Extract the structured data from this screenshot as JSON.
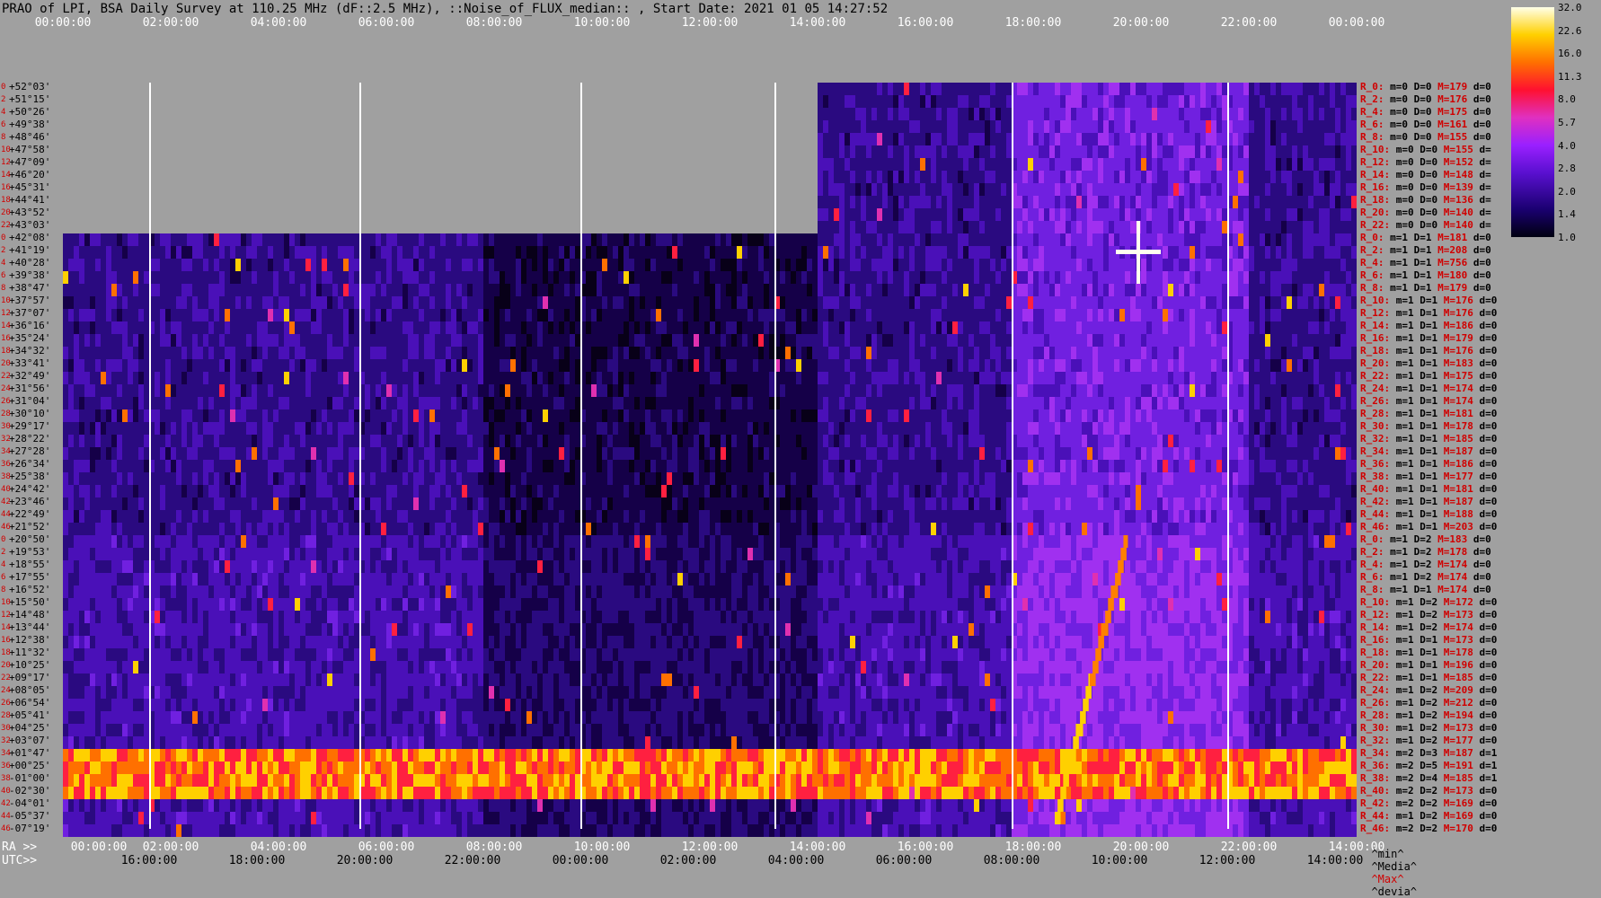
{
  "title": "PRAO of LPI, BSA Daily Survey at 110.25 MHz (dF::2.5 MHz), ::Noise_of_FLUX_median:: , Start Date: 2021 01 05 14:27:52",
  "axis": {
    "top_ticks": [
      "00:00:00",
      "02:00:00",
      "04:00:00",
      "06:00:00",
      "08:00:00",
      "10:00:00",
      "12:00:00",
      "14:00:00",
      "16:00:00",
      "18:00:00",
      "20:00:00",
      "22:00:00",
      "00:00:00"
    ],
    "ra_prefix": "RA >>",
    "ra_ticks": [
      "00:00:00",
      "02:00:00",
      "04:00:00",
      "06:00:00",
      "08:00:00",
      "10:00:00",
      "12:00:00",
      "14:00:00",
      "16:00:00",
      "18:00:00",
      "20:00:00",
      "22:00:00",
      "14:00:00"
    ],
    "utc_prefix": "UTC>>",
    "utc_ticks": [
      "16:00:00",
      "18:00:00",
      "20:00:00",
      "22:00:00",
      "00:00:00",
      "02:00:00",
      "04:00:00",
      "06:00:00",
      "08:00:00",
      "10:00:00",
      "12:00:00",
      "14:00:00"
    ]
  },
  "declinations": [
    "+52°03'",
    "+51°15'",
    "+50°26'",
    "+49°38'",
    "+48°46'",
    "+47°58'",
    "+47°09'",
    "+46°20'",
    "+45°31'",
    "+44°41'",
    "+43°52'",
    "+43°03'",
    "+42°08'",
    "+41°19'",
    "+40°28'",
    "+39°38'",
    "+38°47'",
    "+37°57'",
    "+37°07'",
    "+36°16'",
    "+35°24'",
    "+34°32'",
    "+33°41'",
    "+32°49'",
    "+31°56'",
    "+31°04'",
    "+30°10'",
    "+29°17'",
    "+28°22'",
    "+27°28'",
    "+26°34'",
    "+25°38'",
    "+24°42'",
    "+23°46'",
    "+22°49'",
    "+21°52'",
    "+20°50'",
    "+19°53'",
    "+18°55'",
    "+17°55'",
    "+16°52'",
    "+15°50'",
    "+14°48'",
    "+13°44'",
    "+12°38'",
    "+11°32'",
    "+10°25'",
    "+09°17'",
    "+08°05'",
    "+06°54'",
    "+05°41'",
    "+04°25'",
    "+03°07'",
    "+01°47'",
    "+00°25'",
    "-01°00'",
    "-02°30'",
    "-04°01'",
    "-05°37'",
    "-07°19'"
  ],
  "beam_numbers": [
    "0",
    "2",
    "4",
    "6",
    "8",
    "10",
    "12",
    "14",
    "16",
    "18",
    "20",
    "22",
    "0",
    "2",
    "4",
    "6",
    "8",
    "10",
    "12",
    "14",
    "16",
    "18",
    "20",
    "22",
    "24",
    "26",
    "28",
    "30",
    "32",
    "34",
    "36",
    "38",
    "40",
    "42",
    "44",
    "46",
    "0",
    "2",
    "4",
    "6",
    "8",
    "10",
    "12",
    "14",
    "16",
    "18",
    "20",
    "22",
    "24",
    "26",
    "28",
    "30",
    "32",
    "34",
    "36",
    "38",
    "40",
    "42",
    "44",
    "46"
  ],
  "row_stats": [
    {
      "r": "R_0:",
      "m": "0",
      "d": "0",
      "M": "179",
      "dv": "0"
    },
    {
      "r": "R_2:",
      "m": "0",
      "d": "0",
      "M": "176",
      "dv": "0"
    },
    {
      "r": "R_4:",
      "m": "0",
      "d": "0",
      "M": "175",
      "dv": "0"
    },
    {
      "r": "R_6:",
      "m": "0",
      "d": "0",
      "M": "161",
      "dv": "0"
    },
    {
      "r": "R_8:",
      "m": "0",
      "d": "0",
      "M": "155",
      "dv": "0"
    },
    {
      "r": "R_10:",
      "m": "0",
      "d": "0",
      "M": "155",
      "dv": ""
    },
    {
      "r": "R_12:",
      "m": "0",
      "d": "0",
      "M": "152",
      "dv": ""
    },
    {
      "r": "R_14:",
      "m": "0",
      "d": "0",
      "M": "148",
      "dv": ""
    },
    {
      "r": "R_16:",
      "m": "0",
      "d": "0",
      "M": "139",
      "dv": ""
    },
    {
      "r": "R_18:",
      "m": "0",
      "d": "0",
      "M": "136",
      "dv": ""
    },
    {
      "r": "R_20:",
      "m": "0",
      "d": "0",
      "M": "140",
      "dv": ""
    },
    {
      "r": "R_22:",
      "m": "0",
      "d": "0",
      "M": "140",
      "dv": ""
    },
    {
      "r": "R_0:",
      "m": "1",
      "d": "1",
      "M": "181",
      "dv": "0"
    },
    {
      "r": "R_2:",
      "m": "1",
      "d": "1",
      "M": "208",
      "dv": "0"
    },
    {
      "r": "R_4:",
      "m": "1",
      "d": "1",
      "M": "756",
      "dv": "0"
    },
    {
      "r": "R_6:",
      "m": "1",
      "d": "1",
      "M": "180",
      "dv": "0"
    },
    {
      "r": "R_8:",
      "m": "1",
      "d": "1",
      "M": "179",
      "dv": "0"
    },
    {
      "r": "R_10:",
      "m": "1",
      "d": "1",
      "M": "176",
      "dv": "0"
    },
    {
      "r": "R_12:",
      "m": "1",
      "d": "1",
      "M": "176",
      "dv": "0"
    },
    {
      "r": "R_14:",
      "m": "1",
      "d": "1",
      "M": "186",
      "dv": "0"
    },
    {
      "r": "R_16:",
      "m": "1",
      "d": "1",
      "M": "179",
      "dv": "0"
    },
    {
      "r": "R_18:",
      "m": "1",
      "d": "1",
      "M": "176",
      "dv": "0"
    },
    {
      "r": "R_20:",
      "m": "1",
      "d": "1",
      "M": "183",
      "dv": "0"
    },
    {
      "r": "R_22:",
      "m": "1",
      "d": "1",
      "M": "175",
      "dv": "0"
    },
    {
      "r": "R_24:",
      "m": "1",
      "d": "1",
      "M": "174",
      "dv": "0"
    },
    {
      "r": "R_26:",
      "m": "1",
      "d": "1",
      "M": "174",
      "dv": "0"
    },
    {
      "r": "R_28:",
      "m": "1",
      "d": "1",
      "M": "181",
      "dv": "0"
    },
    {
      "r": "R_30:",
      "m": "1",
      "d": "1",
      "M": "178",
      "dv": "0"
    },
    {
      "r": "R_32:",
      "m": "1",
      "d": "1",
      "M": "185",
      "dv": "0"
    },
    {
      "r": "R_34:",
      "m": "1",
      "d": "1",
      "M": "187",
      "dv": "0"
    },
    {
      "r": "R_36:",
      "m": "1",
      "d": "1",
      "M": "186",
      "dv": "0"
    },
    {
      "r": "R_38:",
      "m": "1",
      "d": "1",
      "M": "177",
      "dv": "0"
    },
    {
      "r": "R_40:",
      "m": "1",
      "d": "1",
      "M": "181",
      "dv": "0"
    },
    {
      "r": "R_42:",
      "m": "1",
      "d": "1",
      "M": "187",
      "dv": "0"
    },
    {
      "r": "R_44:",
      "m": "1",
      "d": "1",
      "M": "188",
      "dv": "0"
    },
    {
      "r": "R_46:",
      "m": "1",
      "d": "1",
      "M": "203",
      "dv": "0"
    },
    {
      "r": "R_0:",
      "m": "1",
      "d": "2",
      "M": "183",
      "dv": "0"
    },
    {
      "r": "R_2:",
      "m": "1",
      "d": "2",
      "M": "178",
      "dv": "0"
    },
    {
      "r": "R_4:",
      "m": "1",
      "d": "2",
      "M": "174",
      "dv": "0"
    },
    {
      "r": "R_6:",
      "m": "1",
      "d": "2",
      "M": "174",
      "dv": "0"
    },
    {
      "r": "R_8:",
      "m": "1",
      "d": "1",
      "M": "174",
      "dv": "0"
    },
    {
      "r": "R_10:",
      "m": "1",
      "d": "2",
      "M": "172",
      "dv": "0"
    },
    {
      "r": "R_12:",
      "m": "1",
      "d": "2",
      "M": "173",
      "dv": "0"
    },
    {
      "r": "R_14:",
      "m": "1",
      "d": "2",
      "M": "174",
      "dv": "0"
    },
    {
      "r": "R_16:",
      "m": "1",
      "d": "1",
      "M": "173",
      "dv": "0"
    },
    {
      "r": "R_18:",
      "m": "1",
      "d": "1",
      "M": "178",
      "dv": "0"
    },
    {
      "r": "R_20:",
      "m": "1",
      "d": "1",
      "M": "196",
      "dv": "0"
    },
    {
      "r": "R_22:",
      "m": "1",
      "d": "1",
      "M": "185",
      "dv": "0"
    },
    {
      "r": "R_24:",
      "m": "1",
      "d": "2",
      "M": "209",
      "dv": "0"
    },
    {
      "r": "R_26:",
      "m": "1",
      "d": "2",
      "M": "212",
      "dv": "0"
    },
    {
      "r": "R_28:",
      "m": "1",
      "d": "2",
      "M": "194",
      "dv": "0"
    },
    {
      "r": "R_30:",
      "m": "1",
      "d": "2",
      "M": "173",
      "dv": "0"
    },
    {
      "r": "R_32:",
      "m": "1",
      "d": "2",
      "M": "177",
      "dv": "0"
    },
    {
      "r": "R_34:",
      "m": "2",
      "d": "3",
      "M": "187",
      "dv": "1"
    },
    {
      "r": "R_36:",
      "m": "2",
      "d": "5",
      "M": "191",
      "dv": "1"
    },
    {
      "r": "R_38:",
      "m": "2",
      "d": "4",
      "M": "185",
      "dv": "1"
    },
    {
      "r": "R_40:",
      "m": "2",
      "d": "2",
      "M": "173",
      "dv": "0"
    },
    {
      "r": "R_42:",
      "m": "2",
      "d": "2",
      "M": "169",
      "dv": "0"
    },
    {
      "r": "R_44:",
      "m": "1",
      "d": "2",
      "M": "169",
      "dv": "0"
    },
    {
      "r": "R_46:",
      "m": "2",
      "d": "2",
      "M": "170",
      "dv": "0"
    }
  ],
  "colorbar": {
    "ticks": [
      "32.0",
      "22.6",
      "16.0",
      "11.3",
      "8.0",
      "5.7",
      "4.0",
      "2.8",
      "2.0",
      "1.4",
      "1.0"
    ]
  },
  "legend": {
    "min": "^min^",
    "median": "^Media^",
    "max": "^Max^",
    "dev": "^devia^"
  },
  "chart_data": {
    "type": "heatmap",
    "title": "PRAO of LPI, BSA Daily Survey at 110.25 MHz (dF::2.5 MHz), ::Noise_of_FLUX_median:: , Start Date: 2021 01 05 14:27:52",
    "x_axis": "RA / UTC (hours, 00:00:00 – 00:00:00)",
    "y_axis": "Declination (+52°03' to -07°19')",
    "color_scale": {
      "min": 1.0,
      "max": 32.0,
      "scale": "log2"
    },
    "features": [
      {
        "desc": "bright ridge band near declination +01°47' to -01°00'",
        "ra_range_h": [
          0,
          24
        ]
      },
      {
        "desc": "bright source near +41°19', RA ~20:00",
        "value": 32
      },
      {
        "desc": "diagonal bright track from ~-05°37' at RA 18:30 to +20°50' at RA 19:40"
      },
      {
        "desc": "empty (no data) region above +43°03' for RA 00:00–14:00"
      }
    ]
  },
  "colors": {
    "background": "#a0a0a0",
    "label_red": "#d00000",
    "label_dark": "#000000"
  }
}
